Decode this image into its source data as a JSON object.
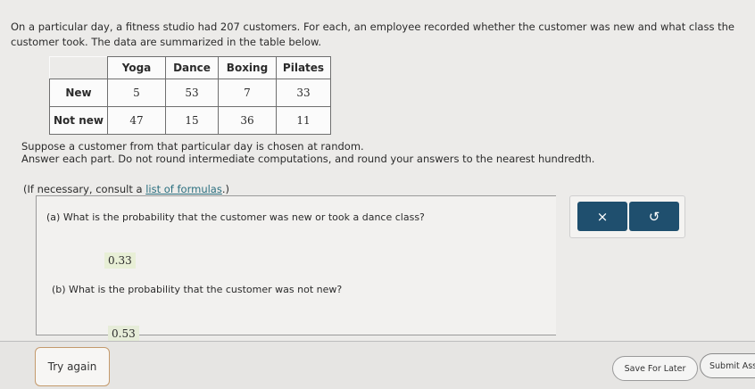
{
  "problem": {
    "intro": "On a particular day, a fitness studio had 207 customers. For each, an employee recorded whether the customer was new and what class the customer took. The data are summarized in the table below.",
    "table": {
      "columns": [
        "Yoga",
        "Dance",
        "Boxing",
        "Pilates"
      ],
      "rows": [
        {
          "label": "New",
          "values": [
            "5",
            "53",
            "7",
            "33"
          ]
        },
        {
          "label": "Not new",
          "values": [
            "47",
            "15",
            "36",
            "11"
          ]
        }
      ]
    },
    "instructions_line1": "Suppose a customer from that particular day is chosen at random.",
    "instructions_line2": "Answer each part. Do not round intermediate computations, and round your answers to the nearest hundredth.",
    "consult_prefix": "(If necessary, consult a ",
    "consult_link": "list of formulas",
    "consult_suffix": ".)"
  },
  "parts": [
    {
      "question": "(a) What is the probability that the customer was new or took a dance class?",
      "answer": "0.33"
    },
    {
      "question": "(b) What is the probability that the customer was not new?",
      "answer": "0.53"
    }
  ],
  "tools": {
    "clear_symbol": "×",
    "undo_symbol": "↺"
  },
  "footer": {
    "try_again": "Try again",
    "save_later": "Save For Later",
    "submit": "Submit Ass"
  }
}
